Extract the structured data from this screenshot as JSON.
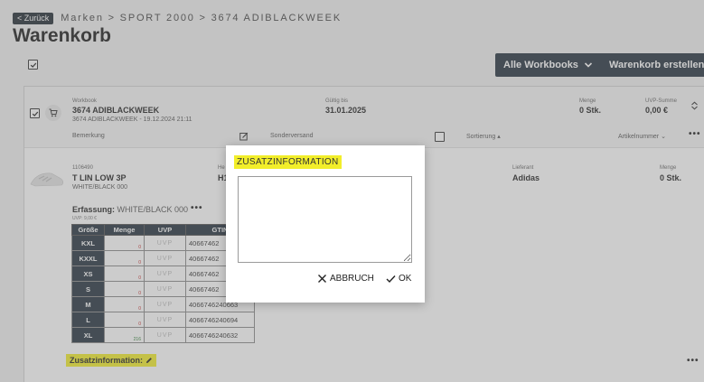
{
  "nav": {
    "back_label": "< Zurück",
    "breadcrumb": "Marken > SPORT 2000 > 3674 ADIBLACKWEEK"
  },
  "page": {
    "title": "Warenkorb"
  },
  "toolbar": {
    "workbooks_label": "Alle Workbooks",
    "create_label": "Warenkorb erstellen"
  },
  "workbook": {
    "label": "Workbook",
    "name": "3674 ADIBLACKWEEK",
    "subtitle": "3674 ADIBLACKWEEK - 19.12.2024 21:11",
    "valid_label": "Gültig bis",
    "valid_value": "31.01.2025",
    "qty_label": "Menge",
    "qty_value": "0 Stk.",
    "uvp_sum_label": "UVP-Summe",
    "uvp_sum_value": "0,00 €",
    "remark_label": "Bemerkung",
    "special_shipping_label": "Sonderversand",
    "sort_label": "Sortierung",
    "sort_by_label": "Artikelnummer"
  },
  "product": {
    "number": "1106490",
    "name": "T LIN LOW 3P",
    "color": "WHITE/BLACK 000",
    "hersteller_label_partial": "He",
    "hersteller_value_partial": "H1",
    "supplier_label": "Lieferant",
    "supplier_value": "Adidas",
    "qty_label": "Menge",
    "qty_value": "0 Stk.",
    "erfassung_label": "Erfassung:",
    "erfassung_value": "WHITE/BLACK 000",
    "uvp_small": "UVP: 9,00 €",
    "zusatz_label": "Zusatzinformation:"
  },
  "size_table": {
    "headers": [
      "Größe",
      "Menge",
      "UVP",
      "GTIN"
    ],
    "rows": [
      {
        "size": "KXL",
        "qty": "0",
        "uvp": "UVP",
        "gtin": "40667462"
      },
      {
        "size": "KXXL",
        "qty": "0",
        "uvp": "UVP",
        "gtin": "40667462"
      },
      {
        "size": "XS",
        "qty": "0",
        "uvp": "UVP",
        "gtin": "40667462"
      },
      {
        "size": "S",
        "qty": "0",
        "uvp": "UVP",
        "gtin": "40667462"
      },
      {
        "size": "M",
        "qty": "0",
        "uvp": "UVP",
        "gtin": "4066746240663"
      },
      {
        "size": "L",
        "qty": "0",
        "uvp": "UVP",
        "gtin": "4066746240694"
      },
      {
        "size": "XL",
        "qty": "216",
        "uvp": "UVP",
        "gtin": "4066746240632"
      }
    ]
  },
  "modal": {
    "title": "ZUSATZINFORMATION",
    "textarea_value": "",
    "cancel_label": "ABBRUCH",
    "ok_label": "OK"
  },
  "colors": {
    "dark": "#26333f",
    "highlight": "#f2ee2a",
    "negative": "#c62828",
    "positive": "#2e7d32"
  }
}
